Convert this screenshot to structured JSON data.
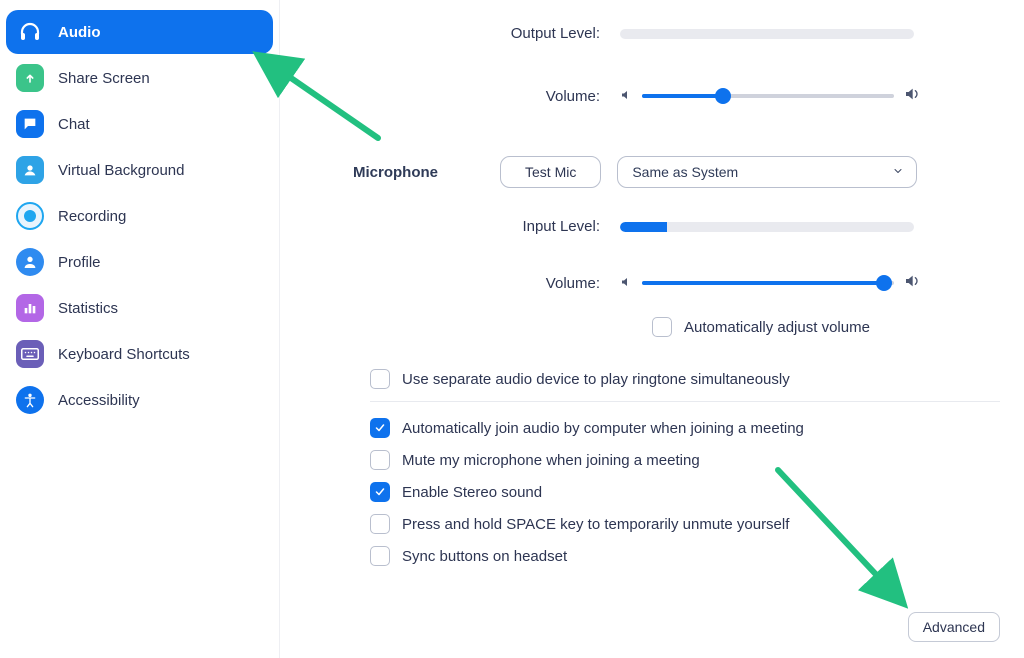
{
  "sidebar": {
    "items": [
      {
        "label": "Audio",
        "active": true,
        "icon": "headphones",
        "bg": "#0e72ed"
      },
      {
        "label": "Share Screen",
        "active": false,
        "icon": "share",
        "bg": "#3bc48a"
      },
      {
        "label": "Chat",
        "active": false,
        "icon": "chat",
        "bg": "#0e72ed"
      },
      {
        "label": "Virtual Background",
        "active": false,
        "icon": "vb",
        "bg": "#2ea3e6"
      },
      {
        "label": "Recording",
        "active": false,
        "icon": "record",
        "bg": "#1ea6f0"
      },
      {
        "label": "Profile",
        "active": false,
        "icon": "profile",
        "bg": "#2f8bf0"
      },
      {
        "label": "Statistics",
        "active": false,
        "icon": "stats",
        "bg": "#b367e6"
      },
      {
        "label": "Keyboard Shortcuts",
        "active": false,
        "icon": "keyboard",
        "bg": "#6b5fb8"
      },
      {
        "label": "Accessibility",
        "active": false,
        "icon": "access",
        "bg": "#0e72ed"
      }
    ]
  },
  "main": {
    "output_level_label": "Output Level:",
    "output_volume_label": "Volume:",
    "microphone_section_label": "Microphone",
    "test_mic_label": "Test Mic",
    "mic_device_selected": "Same as System",
    "input_level_label": "Input Level:",
    "input_volume_label": "Volume:",
    "auto_adjust_label": "Automatically adjust volume",
    "output_level_percent": 0,
    "output_volume_percent": 32,
    "input_level_percent": 16,
    "input_volume_percent": 96,
    "auto_adjust_checked": false,
    "ringtone_checkbox_label": "Use separate audio device to play ringtone simultaneously",
    "ringtone_checked": false,
    "options": [
      {
        "label": "Automatically join audio by computer when joining a meeting",
        "checked": true
      },
      {
        "label": "Mute my microphone when joining a meeting",
        "checked": false
      },
      {
        "label": "Enable Stereo sound",
        "checked": true
      },
      {
        "label": "Press and hold SPACE key to temporarily unmute yourself",
        "checked": false
      },
      {
        "label": "Sync buttons on headset",
        "checked": false
      }
    ],
    "advanced_label": "Advanced"
  }
}
